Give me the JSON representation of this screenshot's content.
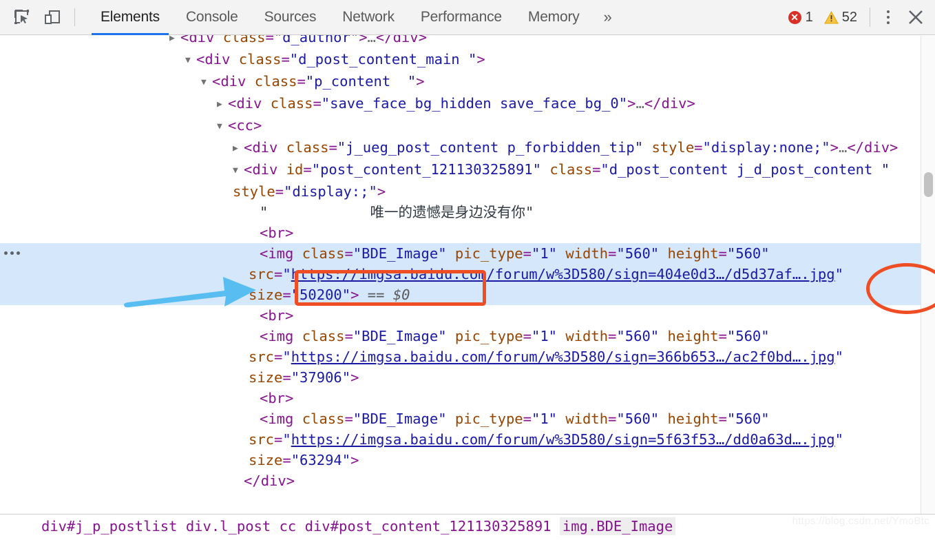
{
  "toolbar": {
    "inspect_icon": "inspect-element-icon",
    "device_icon": "device-toolbar-icon",
    "tabs": [
      {
        "label": "Elements",
        "active": true
      },
      {
        "label": "Console",
        "active": false
      },
      {
        "label": "Sources",
        "active": false
      },
      {
        "label": "Network",
        "active": false
      },
      {
        "label": "Performance",
        "active": false
      },
      {
        "label": "Memory",
        "active": false
      }
    ],
    "more_tabs_label": "»",
    "error_count": "1",
    "warning_count": "52",
    "error_icon": "error-circle-icon",
    "warning_icon": "warning-triangle-icon",
    "menu_icon": "kebab-menu-icon",
    "close_icon": "close-icon",
    "accent_color": "#1a73e8",
    "error_color": "#d93025",
    "warning_color": "#f6c344"
  },
  "dom_tree": {
    "rows": [
      {
        "indent": 0,
        "triangle": "closed",
        "parts": [
          {
            "t": "punct",
            "s": "<"
          },
          {
            "t": "tag",
            "s": "div"
          },
          {
            "t": "attr",
            "s": " class"
          },
          {
            "t": "punct",
            "s": "="
          },
          {
            "t": "val",
            "s": "\"d_author\""
          },
          {
            "t": "punct",
            "s": ">"
          },
          {
            "t": "ellip",
            "s": "…"
          },
          {
            "t": "punct",
            "s": "</"
          },
          {
            "t": "tag",
            "s": "div>"
          }
        ]
      },
      {
        "indent": 1,
        "triangle": "open",
        "parts": [
          {
            "t": "punct",
            "s": "<"
          },
          {
            "t": "tag",
            "s": "div"
          },
          {
            "t": "attr",
            "s": " class"
          },
          {
            "t": "punct",
            "s": "="
          },
          {
            "t": "val",
            "s": "\"d_post_content_main \""
          },
          {
            "t": "punct",
            "s": ">"
          }
        ]
      },
      {
        "indent": 2,
        "triangle": "open",
        "parts": [
          {
            "t": "punct",
            "s": "<"
          },
          {
            "t": "tag",
            "s": "div"
          },
          {
            "t": "attr",
            "s": " class"
          },
          {
            "t": "punct",
            "s": "="
          },
          {
            "t": "val",
            "s": "\"p_content  \""
          },
          {
            "t": "punct",
            "s": ">"
          }
        ]
      },
      {
        "indent": 3,
        "triangle": "closed",
        "parts": [
          {
            "t": "punct",
            "s": "<"
          },
          {
            "t": "tag",
            "s": "div"
          },
          {
            "t": "attr",
            "s": " class"
          },
          {
            "t": "punct",
            "s": "="
          },
          {
            "t": "val",
            "s": "\"save_face_bg_hidden save_face_bg_0\""
          },
          {
            "t": "punct",
            "s": ">"
          },
          {
            "t": "ellip",
            "s": "…"
          },
          {
            "t": "punct",
            "s": "</"
          },
          {
            "t": "tag",
            "s": "div>"
          }
        ]
      },
      {
        "indent": 3,
        "triangle": "open",
        "parts": [
          {
            "t": "punct",
            "s": "<"
          },
          {
            "t": "tag",
            "s": "cc"
          },
          {
            "t": "punct",
            "s": ">"
          }
        ]
      },
      {
        "indent": 4,
        "triangle": "closed",
        "parts": [
          {
            "t": "punct",
            "s": "<"
          },
          {
            "t": "tag",
            "s": "div"
          },
          {
            "t": "attr",
            "s": " class"
          },
          {
            "t": "punct",
            "s": "="
          },
          {
            "t": "val",
            "s": "\"j_ueg_post_content p_forbidden_tip\""
          },
          {
            "t": "attr",
            "s": " style"
          },
          {
            "t": "punct",
            "s": "="
          },
          {
            "t": "val",
            "s": "\"display:none;\""
          },
          {
            "t": "punct",
            "s": ">"
          },
          {
            "t": "ellip",
            "s": "…"
          },
          {
            "t": "punct",
            "s": "</"
          },
          {
            "t": "tag",
            "s": "div>"
          }
        ]
      },
      {
        "indent": 4,
        "triangle": "open",
        "parts": [
          {
            "t": "punct",
            "s": "<"
          },
          {
            "t": "tag",
            "s": "div"
          },
          {
            "t": "attr",
            "s": " id"
          },
          {
            "t": "punct",
            "s": "="
          },
          {
            "t": "val",
            "s": "\"post_content_121130325891\""
          },
          {
            "t": "attr",
            "s": " class"
          },
          {
            "t": "punct",
            "s": "="
          },
          {
            "t": "val",
            "s": "\"d_post_content j_d_post_content \""
          },
          {
            "t": "attr",
            "s": " style"
          },
          {
            "t": "punct",
            "s": "="
          },
          {
            "t": "val",
            "s": "\"display:;\""
          },
          {
            "t": "punct",
            "s": ">"
          }
        ]
      },
      {
        "indent": 5,
        "triangle": "none",
        "parts": [
          {
            "t": "txt",
            "s": "\"            唯一的遗憾是身边没有你\""
          }
        ]
      },
      {
        "indent": 5,
        "triangle": "none",
        "parts": [
          {
            "t": "punct",
            "s": "<"
          },
          {
            "t": "tag",
            "s": "br"
          },
          {
            "t": "punct",
            "s": ">"
          }
        ]
      },
      {
        "indent": 5,
        "triangle": "none",
        "selected": true,
        "parts": [
          {
            "t": "punct",
            "s": "<"
          },
          {
            "t": "tag",
            "s": "img"
          },
          {
            "t": "attr",
            "s": " class"
          },
          {
            "t": "punct",
            "s": "="
          },
          {
            "t": "val",
            "s": "\"BDE_Image\""
          },
          {
            "t": "attr",
            "s": " pic_type"
          },
          {
            "t": "punct",
            "s": "="
          },
          {
            "t": "val",
            "s": "\"1\""
          },
          {
            "t": "attr",
            "s": " width"
          },
          {
            "t": "punct",
            "s": "="
          },
          {
            "t": "val",
            "s": "\"560\""
          },
          {
            "t": "attr",
            "s": " height"
          },
          {
            "t": "punct",
            "s": "="
          },
          {
            "t": "val",
            "s": "\"560\""
          },
          {
            "t": "attr",
            "s": " src"
          },
          {
            "t": "punct",
            "s": "="
          },
          {
            "t": "val",
            "s": "\""
          },
          {
            "t": "link",
            "s": "https://imgsa.baidu.com/forum/w%3D580/sign=404e0d3…/d5d37af….jpg"
          },
          {
            "t": "val",
            "s": "\""
          },
          {
            "t": "attr",
            "s": " size"
          },
          {
            "t": "punct",
            "s": "="
          },
          {
            "t": "val",
            "s": "\"50200\""
          },
          {
            "t": "punct",
            "s": ">"
          },
          {
            "t": "eqeq",
            "s": " == "
          },
          {
            "t": "dollar",
            "s": "$0"
          }
        ]
      },
      {
        "indent": 5,
        "triangle": "none",
        "parts": [
          {
            "t": "punct",
            "s": "<"
          },
          {
            "t": "tag",
            "s": "br"
          },
          {
            "t": "punct",
            "s": ">"
          }
        ]
      },
      {
        "indent": 5,
        "triangle": "none",
        "parts": [
          {
            "t": "punct",
            "s": "<"
          },
          {
            "t": "tag",
            "s": "img"
          },
          {
            "t": "attr",
            "s": " class"
          },
          {
            "t": "punct",
            "s": "="
          },
          {
            "t": "val",
            "s": "\"BDE_Image\""
          },
          {
            "t": "attr",
            "s": " pic_type"
          },
          {
            "t": "punct",
            "s": "="
          },
          {
            "t": "val",
            "s": "\"1\""
          },
          {
            "t": "attr",
            "s": " width"
          },
          {
            "t": "punct",
            "s": "="
          },
          {
            "t": "val",
            "s": "\"560\""
          },
          {
            "t": "attr",
            "s": " height"
          },
          {
            "t": "punct",
            "s": "="
          },
          {
            "t": "val",
            "s": "\"560\""
          },
          {
            "t": "attr",
            "s": " src"
          },
          {
            "t": "punct",
            "s": "="
          },
          {
            "t": "val",
            "s": "\""
          },
          {
            "t": "link",
            "s": "https://imgsa.baidu.com/forum/w%3D580/sign=366b653…/ac2f0bd….jpg"
          },
          {
            "t": "val",
            "s": "\""
          },
          {
            "t": "attr",
            "s": " size"
          },
          {
            "t": "punct",
            "s": "="
          },
          {
            "t": "val",
            "s": "\"37906\""
          },
          {
            "t": "punct",
            "s": ">"
          }
        ]
      },
      {
        "indent": 5,
        "triangle": "none",
        "parts": [
          {
            "t": "punct",
            "s": "<"
          },
          {
            "t": "tag",
            "s": "br"
          },
          {
            "t": "punct",
            "s": ">"
          }
        ]
      },
      {
        "indent": 5,
        "triangle": "none",
        "parts": [
          {
            "t": "punct",
            "s": "<"
          },
          {
            "t": "tag",
            "s": "img"
          },
          {
            "t": "attr",
            "s": " class"
          },
          {
            "t": "punct",
            "s": "="
          },
          {
            "t": "val",
            "s": "\"BDE_Image\""
          },
          {
            "t": "attr",
            "s": " pic_type"
          },
          {
            "t": "punct",
            "s": "="
          },
          {
            "t": "val",
            "s": "\"1\""
          },
          {
            "t": "attr",
            "s": " width"
          },
          {
            "t": "punct",
            "s": "="
          },
          {
            "t": "val",
            "s": "\"560\""
          },
          {
            "t": "attr",
            "s": " height"
          },
          {
            "t": "punct",
            "s": "="
          },
          {
            "t": "val",
            "s": "\"560\""
          },
          {
            "t": "attr",
            "s": " src"
          },
          {
            "t": "punct",
            "s": "="
          },
          {
            "t": "val",
            "s": "\""
          },
          {
            "t": "link",
            "s": "https://imgsa.baidu.com/forum/w%3D580/sign=5f63f53…/dd0a63d….jpg"
          },
          {
            "t": "val",
            "s": "\""
          },
          {
            "t": "attr",
            "s": " size"
          },
          {
            "t": "punct",
            "s": "="
          },
          {
            "t": "val",
            "s": "\"63294\""
          },
          {
            "t": "punct",
            "s": ">"
          }
        ]
      },
      {
        "indent": 4,
        "triangle": "none",
        "parts": [
          {
            "t": "punct",
            "s": "</"
          },
          {
            "t": "tag",
            "s": "div>"
          }
        ]
      }
    ]
  },
  "breadcrumb": {
    "text": "div#j_p_postlist    div.l_post    cc    div#post_content_121130325891    img.BDE_Image",
    "highlighted": "img.BDE_Image"
  },
  "watermark": {
    "text": "https://blog.csdn.net/YmoBtc"
  },
  "annotations": {
    "class_rect_label": "highlight-rect-class-attribute",
    "src_ellipse_label": "highlight-ellipse-src-attribute",
    "arrow_label": "pointer-arrow-to-img-row",
    "color": "#ef4d23",
    "arrow_color": "#58bdf0"
  },
  "scrollbar": {
    "orientation": "vertical"
  }
}
